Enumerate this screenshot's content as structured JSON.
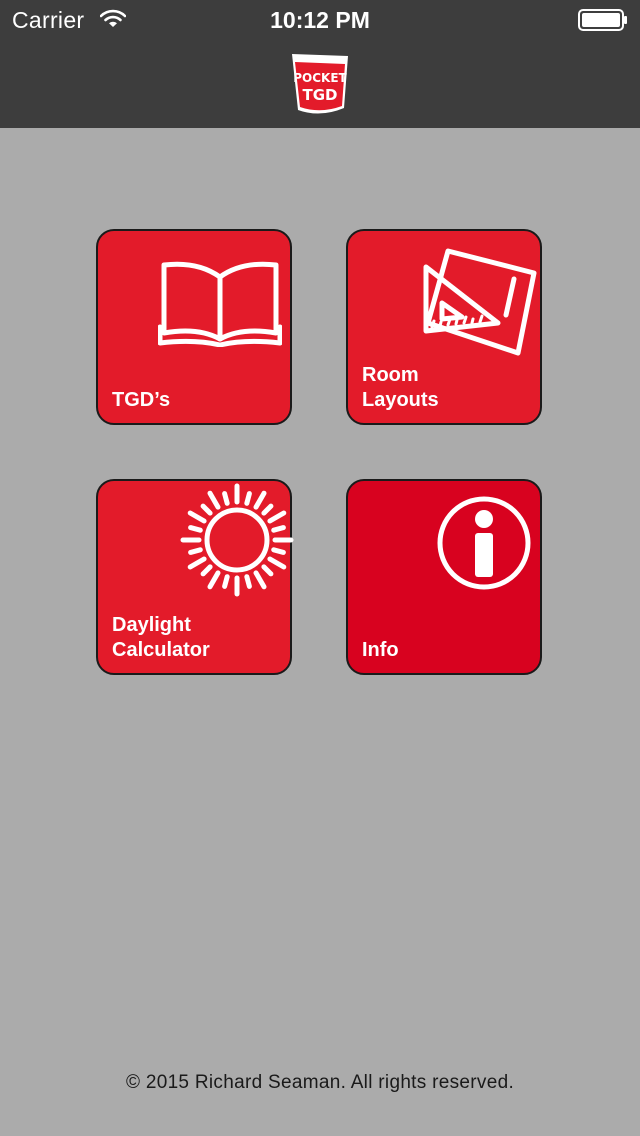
{
  "status_bar": {
    "carrier": "Carrier",
    "time": "10:12 PM"
  },
  "header": {
    "logo_lines": [
      "POCKET",
      "TGD"
    ]
  },
  "tiles": [
    {
      "label": "TGD’s",
      "icon": "open-book-icon"
    },
    {
      "label": "Room\nLayouts",
      "icon": "set-square-drawing-icon"
    },
    {
      "label": "Daylight\nCalculator",
      "icon": "sun-icon"
    },
    {
      "label": "Info",
      "icon": "info-icon"
    }
  ],
  "footer": {
    "copyright": "© 2015 Richard Seaman. All rights reserved."
  },
  "colors": {
    "header_bg": "#3d3d3d",
    "page_bg": "#ababab",
    "tile_red": "#e31b2a",
    "info_red": "#d8021f"
  }
}
